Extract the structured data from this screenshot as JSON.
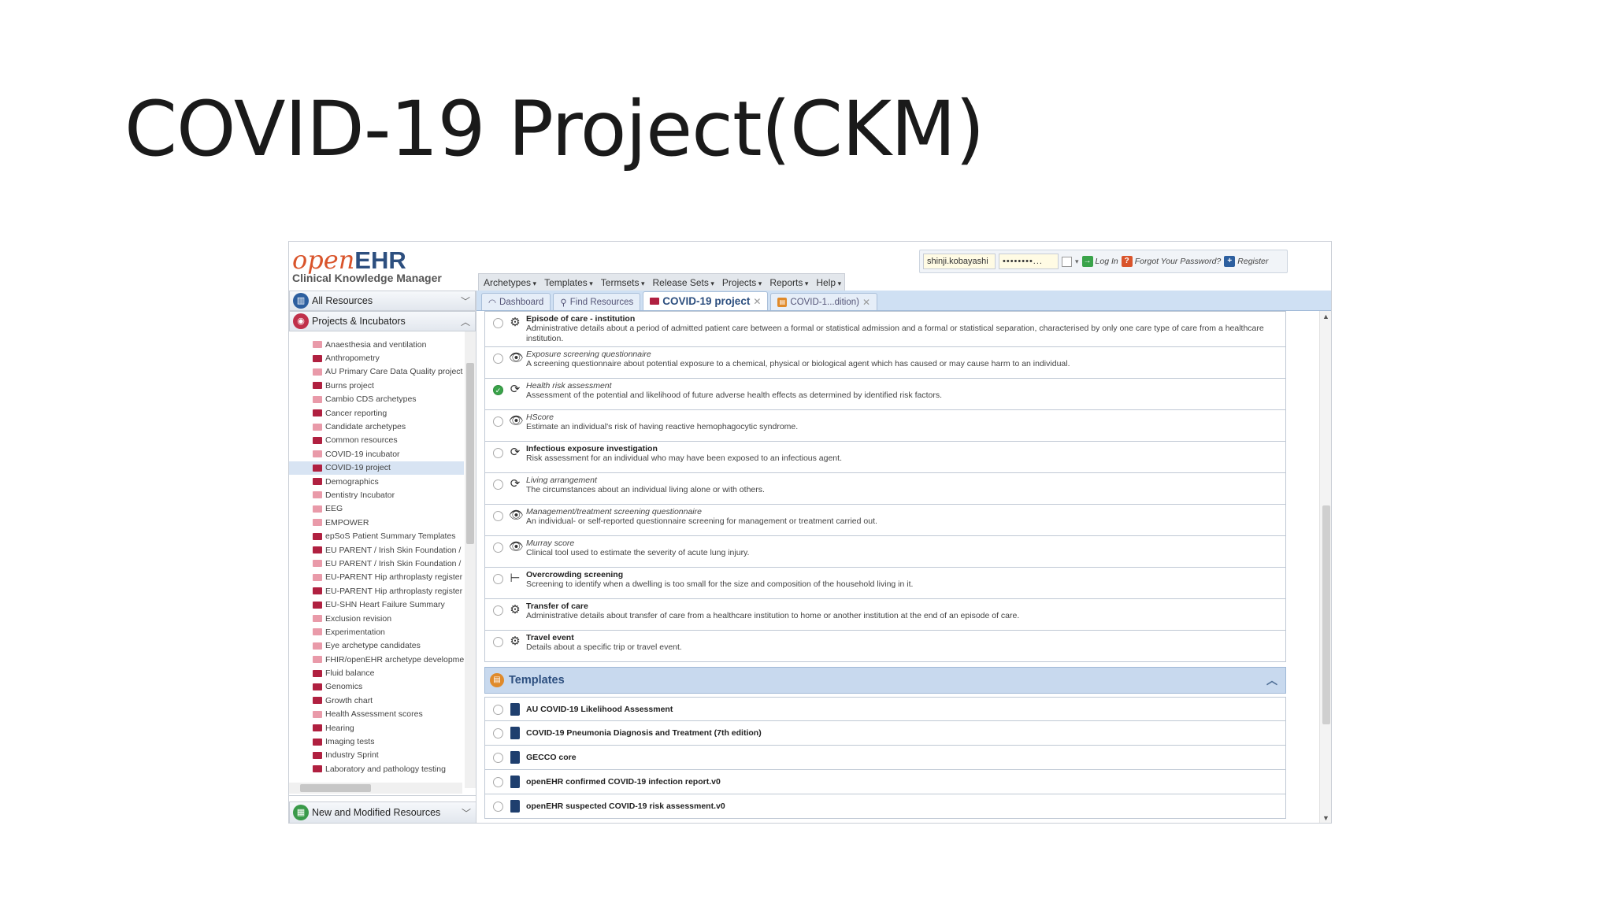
{
  "slide": {
    "title": "COVID-19 Project(CKM)"
  },
  "app": {
    "logo": {
      "open": "open",
      "ehr": "EHR",
      "subtitle": "Clinical Knowledge Manager"
    },
    "login": {
      "username": "shinji.kobayashi",
      "password": "••••••••...",
      "login_label": "Log In",
      "forgot_label": "Forgot Your Password?",
      "register_label": "Register"
    },
    "menu": [
      "Archetypes",
      "Templates",
      "Termsets",
      "Release Sets",
      "Projects",
      "Reports",
      "Help"
    ],
    "sidebar": {
      "all_resources": "All Resources",
      "projects_incubators": "Projects & Incubators",
      "new_modified": "New and Modified Resources",
      "items": [
        {
          "label": "Anaesthesia and ventilation",
          "style": "light"
        },
        {
          "label": "Anthropometry",
          "style": "dark"
        },
        {
          "label": "AU Primary Care Data Quality project",
          "style": "light"
        },
        {
          "label": "Burns project",
          "style": "dark"
        },
        {
          "label": "Cambio CDS archetypes",
          "style": "light"
        },
        {
          "label": "Cancer reporting",
          "style": "dark"
        },
        {
          "label": "Candidate archetypes",
          "style": "light"
        },
        {
          "label": "Common resources",
          "style": "dark"
        },
        {
          "label": "COVID-19 incubator",
          "style": "light"
        },
        {
          "label": "COVID-19 project",
          "style": "dark",
          "selected": true
        },
        {
          "label": "Demographics",
          "style": "dark"
        },
        {
          "label": "Dentistry Incubator",
          "style": "light"
        },
        {
          "label": "EEG",
          "style": "light"
        },
        {
          "label": "EMPOWER",
          "style": "light"
        },
        {
          "label": "epSoS Patient Summary Templates",
          "style": "dark"
        },
        {
          "label": "EU PARENT / Irish Skin Foundation /",
          "style": "dark"
        },
        {
          "label": "EU PARENT / Irish Skin Foundation /",
          "style": "light"
        },
        {
          "label": "EU-PARENT Hip arthroplasty register",
          "style": "light"
        },
        {
          "label": "EU-PARENT Hip arthroplasty register",
          "style": "dark"
        },
        {
          "label": "EU-SHN Heart Failure Summary",
          "style": "dark"
        },
        {
          "label": "Exclusion revision",
          "style": "light"
        },
        {
          "label": "Experimentation",
          "style": "light"
        },
        {
          "label": "Eye archetype candidates",
          "style": "light"
        },
        {
          "label": "FHIR/openEHR archetype development",
          "style": "light"
        },
        {
          "label": "Fluid balance",
          "style": "dark"
        },
        {
          "label": "Genomics",
          "style": "dark"
        },
        {
          "label": "Growth chart",
          "style": "dark"
        },
        {
          "label": "Health Assessment scores",
          "style": "light"
        },
        {
          "label": "Hearing",
          "style": "dark"
        },
        {
          "label": "Imaging tests",
          "style": "dark"
        },
        {
          "label": "Industry Sprint",
          "style": "dark"
        },
        {
          "label": "Laboratory and pathology testing",
          "style": "dark"
        }
      ]
    },
    "tabs": [
      {
        "label": "Dashboard"
      },
      {
        "label": "Find Resources"
      },
      {
        "label": "COVID-19 project",
        "active": true
      },
      {
        "label": "COVID-1...dition)"
      }
    ],
    "archetypes": [
      {
        "name": "Episode of care - institution",
        "style": "b",
        "icon": "gear",
        "desc": "Administrative details about a period of admitted patient care between a formal or statistical admission and a formal or statistical separation, characterised by only one care type of care from a healthcare institution."
      },
      {
        "name": "Exposure screening questionnaire",
        "style": "i",
        "icon": "eye",
        "desc": "A screening questionnaire about potential exposure to a chemical, physical or biological agent which has caused or may cause harm to an individual."
      },
      {
        "name": "Health risk assessment",
        "style": "i",
        "icon": "cycle",
        "checked": true,
        "desc": "Assessment of the potential and likelihood of future adverse health effects as determined by identified risk factors."
      },
      {
        "name": "HScore",
        "style": "i",
        "icon": "eye",
        "desc": "Estimate an individual's risk of having reactive hemophagocytic syndrome."
      },
      {
        "name": "Infectious exposure investigation",
        "style": "b",
        "icon": "cycle",
        "desc": "Risk assessment for an individual who may have been exposed to an infectious agent."
      },
      {
        "name": "Living arrangement",
        "style": "i",
        "icon": "cycle",
        "desc": "The circumstances about an individual living alone or with others."
      },
      {
        "name": "Management/treatment screening questionnaire",
        "style": "i",
        "icon": "eye",
        "desc": "An individual- or self-reported questionnaire screening for management or treatment carried out."
      },
      {
        "name": "Murray score",
        "style": "i",
        "icon": "eye",
        "desc": "Clinical tool used to estimate the severity of acute lung injury."
      },
      {
        "name": "Overcrowding screening",
        "style": "b",
        "icon": "tree",
        "desc": "Screening to identify when a dwelling is too small for the size and composition of the household living in it."
      },
      {
        "name": "Transfer of care",
        "style": "b",
        "icon": "gear",
        "desc": "Administrative details about transfer of care from a healthcare institution to home or another institution at the end of an episode of care."
      },
      {
        "name": "Travel event",
        "style": "b",
        "icon": "gear",
        "desc": "Details about a specific trip or travel event."
      }
    ],
    "templates_header": "Templates",
    "templates": [
      "AU COVID-19 Likelihood Assessment",
      "COVID-19 Pneumonia Diagnosis and Treatment (7th edition)",
      "GECCO core",
      "openEHR confirmed COVID-19 infection report.v0",
      "openEHR suspected COVID-19 risk assessment.v0"
    ],
    "colors": {
      "accent": "#2d4f7f",
      "logo_open": "#d9542b",
      "tab_bar": "#cfe0f3",
      "project_icon": "#b02040"
    }
  }
}
